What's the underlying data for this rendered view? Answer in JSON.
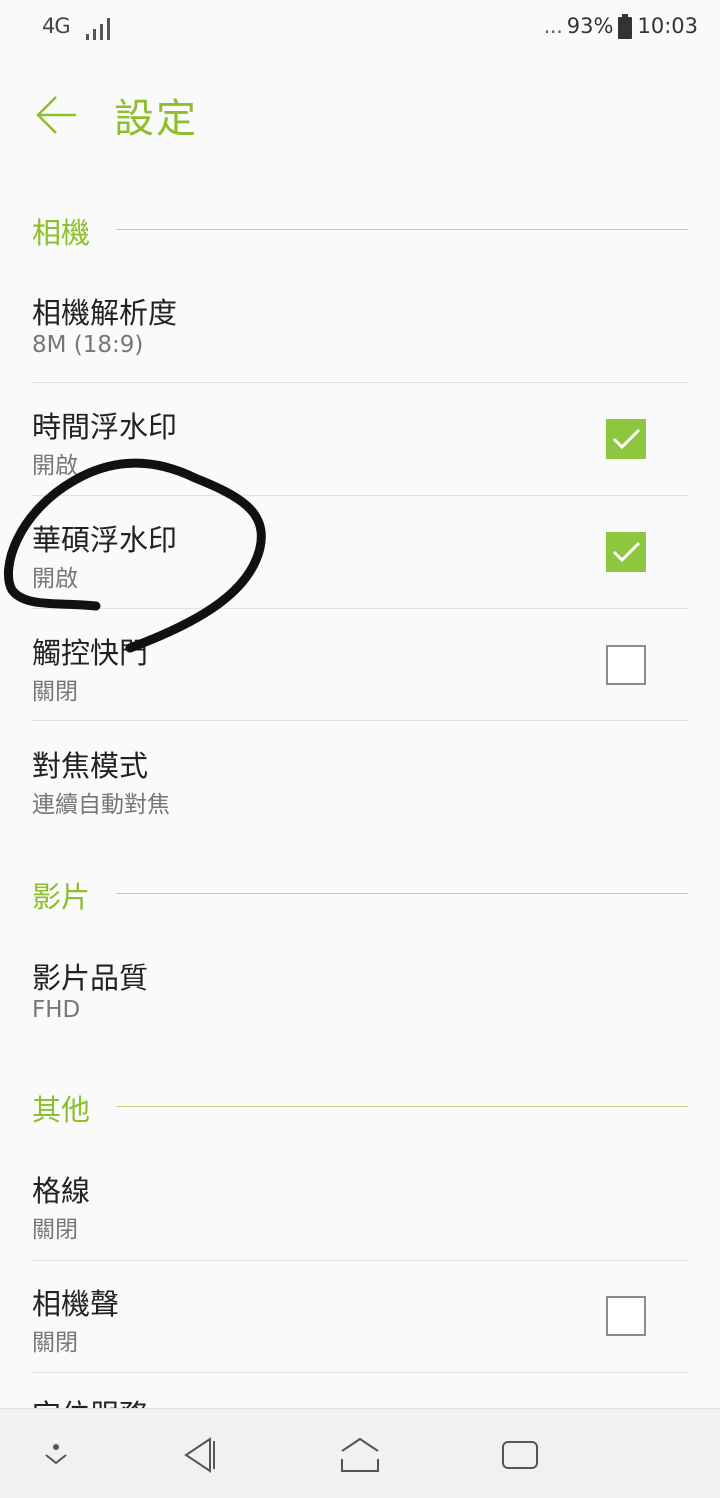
{
  "status": {
    "network": "4G",
    "battery_dots": "...",
    "battery": "93%",
    "time": "10:03"
  },
  "header": {
    "title": "設定"
  },
  "sections": {
    "camera": "相機",
    "video": "影片",
    "other": "其他"
  },
  "items": {
    "resolution": {
      "title": "相機解析度",
      "value": "8M (18:9)"
    },
    "time_watermark": {
      "title": "時間浮水印",
      "value": "開啟",
      "checked": true
    },
    "asus_watermark": {
      "title": "華碩浮水印",
      "value": "開啟",
      "checked": true
    },
    "touch_shutter": {
      "title": "觸控快門",
      "value": "關閉",
      "checked": false
    },
    "focus_mode": {
      "title": "對焦模式",
      "value": "連續自動對焦"
    },
    "video_quality": {
      "title": "影片品質",
      "value": "FHD"
    },
    "grid": {
      "title": "格線",
      "value": "關閉"
    },
    "camera_sound": {
      "title": "相機聲",
      "value": "關閉",
      "checked": false
    },
    "location": {
      "title": "定位服務"
    }
  },
  "colors": {
    "accent": "#8dbf2d",
    "checkbox_on": "#8dc63f"
  }
}
